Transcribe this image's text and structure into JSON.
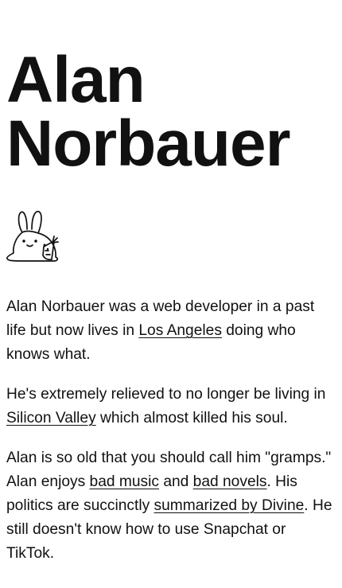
{
  "header": {
    "name_first": "Alan",
    "name_last": "Norbauer"
  },
  "mascot": {
    "icon": "bunny-with-carrot-icon"
  },
  "bio": {
    "p1": {
      "t1": "Alan Norbauer was a web developer in a past life but now lives in ",
      "link_la": "Los Angeles",
      "t2": " doing who knows what."
    },
    "p2": {
      "t1": "He's extremely relieved to no longer be living in ",
      "link_sv": "Silicon Valley",
      "t2": " which almost killed his soul."
    },
    "p3": {
      "t1": "Alan is so old that you should call him \"gramps.\" Alan enjoys ",
      "link_music": "bad music",
      "t2": " and ",
      "link_novels": "bad novels",
      "t3": ". His politics are succinctly ",
      "link_divine": "summarized by Divine",
      "t4": ". He still doesn't know how to use Snapchat or TikTok."
    }
  },
  "theme_toggle": {
    "icon": "sun-icon"
  }
}
